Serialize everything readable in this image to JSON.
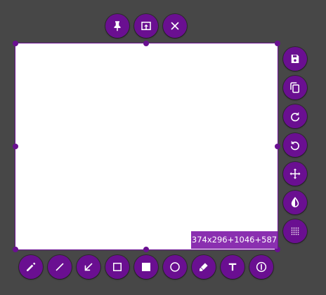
{
  "selection": {
    "geometry_label": "374x296+1046+587"
  },
  "colors": {
    "background": "#474747",
    "accent": "#6a0f91",
    "label_bg": "#8a2fb0",
    "canvas": "#ffffff"
  },
  "top_toolbar": [
    {
      "name": "pin-button",
      "icon": "pin-icon"
    },
    {
      "name": "upload-button",
      "icon": "upload-icon"
    },
    {
      "name": "close-button",
      "icon": "close-icon"
    }
  ],
  "side_toolbar": [
    {
      "name": "save-button",
      "icon": "save-icon"
    },
    {
      "name": "copy-button",
      "icon": "copy-icon"
    },
    {
      "name": "redo-button",
      "icon": "redo-icon"
    },
    {
      "name": "undo-button",
      "icon": "undo-icon"
    },
    {
      "name": "move-button",
      "icon": "move-icon"
    },
    {
      "name": "invert-button",
      "icon": "invert-icon"
    },
    {
      "name": "pixelate-button",
      "icon": "pixelate-icon"
    }
  ],
  "bottom_toolbar": [
    {
      "name": "pencil-button",
      "icon": "pencil-icon"
    },
    {
      "name": "line-button",
      "icon": "line-icon"
    },
    {
      "name": "arrow-button",
      "icon": "arrow-icon"
    },
    {
      "name": "rectangle-button",
      "icon": "rectangle-icon"
    },
    {
      "name": "filled-rectangle-button",
      "icon": "filled-rectangle-icon"
    },
    {
      "name": "circle-button",
      "icon": "circle-icon"
    },
    {
      "name": "marker-button",
      "icon": "marker-icon"
    },
    {
      "name": "text-button",
      "icon": "text-icon"
    },
    {
      "name": "counter-button",
      "icon": "counter-icon"
    }
  ]
}
